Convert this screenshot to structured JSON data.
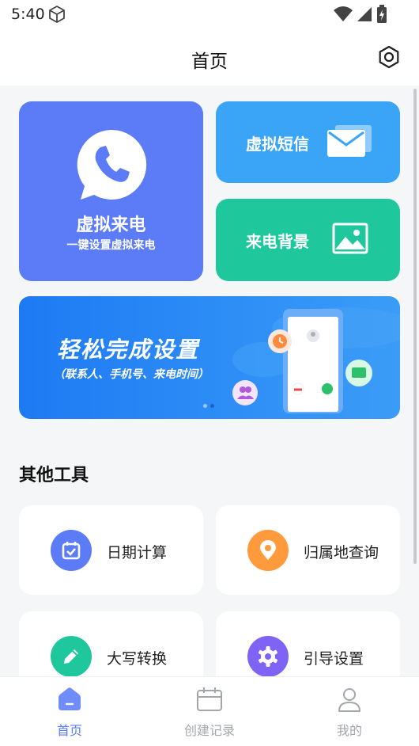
{
  "status_bar": {
    "time": "5:40"
  },
  "header": {
    "title": "首页"
  },
  "cards": {
    "virtual_call": {
      "title": "虚拟来电",
      "subtitle": "一键设置虚拟来电"
    },
    "virtual_sms": {
      "title": "虚拟短信"
    },
    "call_background": {
      "title": "来电背景"
    }
  },
  "banner": {
    "title": "轻松完成设置",
    "subtitle": "（联系人、手机号、来电时间）",
    "slides": 2,
    "active_slide": 1
  },
  "section": {
    "title": "其他工具"
  },
  "tools": [
    {
      "label": "日期计算",
      "icon": "calendar-icon",
      "color": "#5b7cf6"
    },
    {
      "label": "归属地查询",
      "icon": "location-pin-icon",
      "color": "#ff9a3d"
    },
    {
      "label": "大写转换",
      "icon": "pencil-icon",
      "color": "#1ec79c"
    },
    {
      "label": "引导设置",
      "icon": "gear-icon",
      "color": "#7f63f4"
    }
  ],
  "tabbar": {
    "items": [
      {
        "label": "首页",
        "icon": "home-icon",
        "active": true
      },
      {
        "label": "创建记录",
        "icon": "calendar-record-icon",
        "active": false
      },
      {
        "label": "我的",
        "icon": "profile-icon",
        "active": false
      }
    ]
  },
  "colors": {
    "primary": "#5b7cf6",
    "sms_card": "#3aa4f6",
    "background_card": "#1ec79c",
    "page_background": "#f5f6f8"
  }
}
